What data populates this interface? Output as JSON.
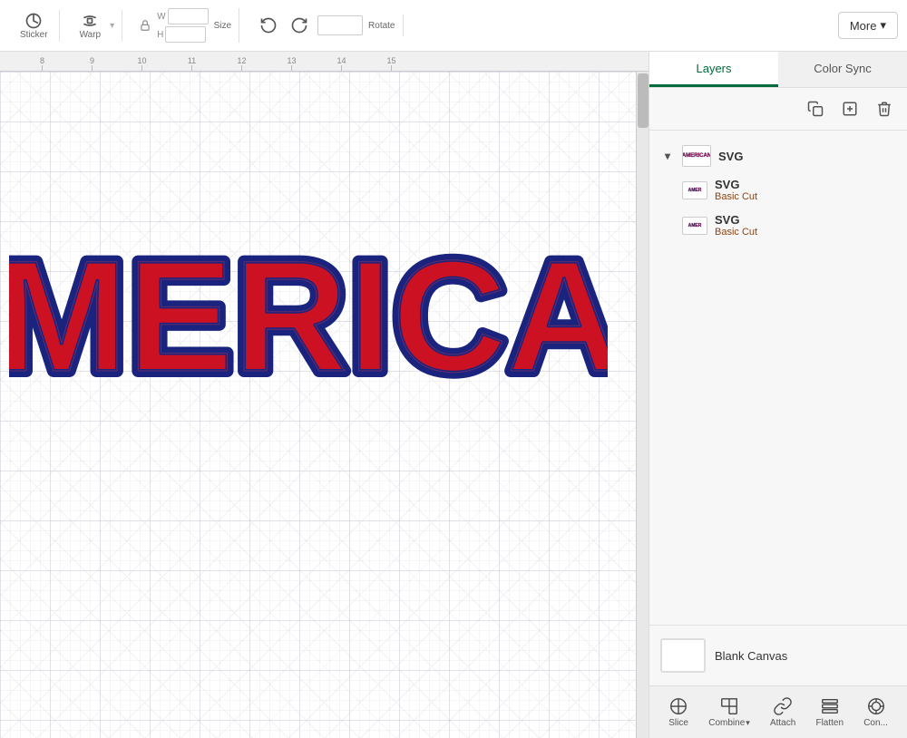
{
  "toolbar": {
    "sticker_label": "Sticker",
    "warp_label": "Warp",
    "size_label": "Size",
    "rotate_label": "Rotate",
    "more_label": "More",
    "more_arrow": "▾"
  },
  "ruler": {
    "marks": [
      "8",
      "9",
      "10",
      "11",
      "12",
      "13",
      "14",
      "15"
    ]
  },
  "canvas": {
    "american_text": "AMERICAN"
  },
  "right_panel": {
    "tabs": [
      {
        "id": "layers",
        "label": "Layers",
        "active": true
      },
      {
        "id": "color_sync",
        "label": "Color Sync",
        "active": false
      }
    ],
    "toolbar_icons": [
      "duplicate",
      "add",
      "delete"
    ],
    "layers": [
      {
        "id": "group1",
        "name": "SVG",
        "type": "group",
        "expanded": true,
        "children": [
          {
            "id": "layer1",
            "name": "SVG",
            "sub": "Basic Cut"
          },
          {
            "id": "layer2",
            "name": "SVG",
            "sub": "Basic Cut"
          }
        ]
      }
    ],
    "blank_canvas": {
      "label": "Blank Canvas"
    }
  },
  "bottom_toolbar": {
    "buttons": [
      {
        "id": "slice",
        "label": "Slice"
      },
      {
        "id": "combine",
        "label": "Combine"
      },
      {
        "id": "attach",
        "label": "Attach"
      },
      {
        "id": "flatten",
        "label": "Flatten"
      },
      {
        "id": "contour",
        "label": "Con..."
      }
    ]
  }
}
